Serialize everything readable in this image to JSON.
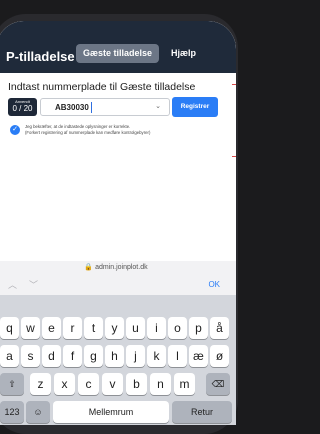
{
  "header": {
    "title": "P-tilladelse",
    "tabs": [
      {
        "label": "Gæste tilladelse"
      },
      {
        "label": "Hjælp"
      }
    ]
  },
  "form": {
    "heading": "Indtast nummerplade til Gæste tilladelse",
    "counter_label": "Anvendt",
    "counter_value": "0 / 20",
    "plate_value": "AB30030",
    "register_label": "Registrer",
    "consent_line1": "Jeg bekræfter, at de indtastede oplysninger er korrekte.",
    "consent_line2": "(Forkert registrering af nummerplade kan medføre kontrolgebyrer)"
  },
  "browser": {
    "url": "admin.joinplot.dk",
    "done_label": "OK"
  },
  "keyboard": {
    "row1": [
      "q",
      "w",
      "e",
      "r",
      "t",
      "y",
      "u",
      "i",
      "o",
      "p",
      "å"
    ],
    "row2": [
      "a",
      "s",
      "d",
      "f",
      "g",
      "h",
      "j",
      "k",
      "l",
      "æ",
      "ø"
    ],
    "row3": [
      "z",
      "x",
      "c",
      "v",
      "b",
      "n",
      "m"
    ],
    "numbers_key": "123",
    "space_label": "Mellemrum",
    "return_label": "Retur"
  }
}
